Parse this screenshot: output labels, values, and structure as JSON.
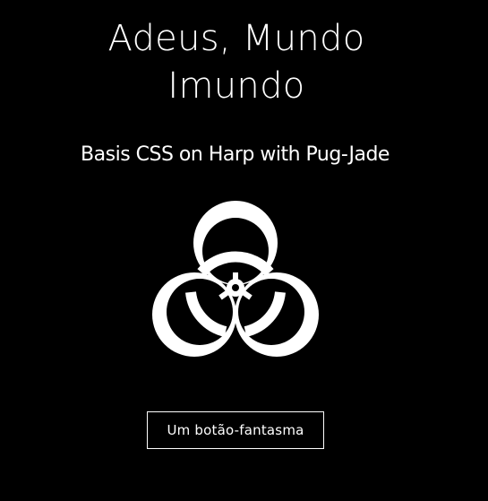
{
  "header": {
    "title_line_1": "Adeus, Mundo",
    "title_line_2": "Imundo",
    "subtitle": "Basis CSS on Harp with Pug-Jade"
  },
  "hero": {
    "icon": "biohazard-icon"
  },
  "actions": {
    "ghost_button_label": "Um botão-fantasma"
  },
  "colors": {
    "background": "#000000",
    "foreground": "#ffffff"
  }
}
